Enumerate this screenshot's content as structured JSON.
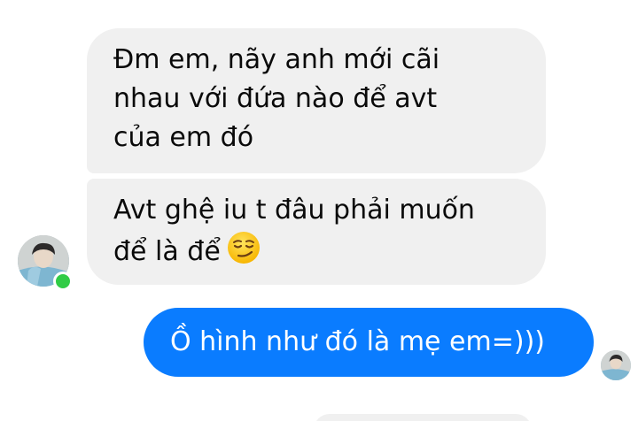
{
  "conversation": {
    "messages": [
      {
        "direction": "incoming",
        "text": "Đm em, nãy anh mới cãi\nnhau với đứa nào để avt\ncủa em đó"
      },
      {
        "direction": "incoming",
        "text": "Avt ghệ iu t đâu phải muốn\nđể là để",
        "emoji": "smirking-face-icon"
      },
      {
        "direction": "outgoing",
        "text": "Ồ hình như đó là mẹ em=)))"
      }
    ],
    "contact_status": "online"
  },
  "colors": {
    "incoming_bubble": "#f0f0f0",
    "outgoing_bubble": "#0a7cff",
    "online_indicator": "#31cc46"
  }
}
